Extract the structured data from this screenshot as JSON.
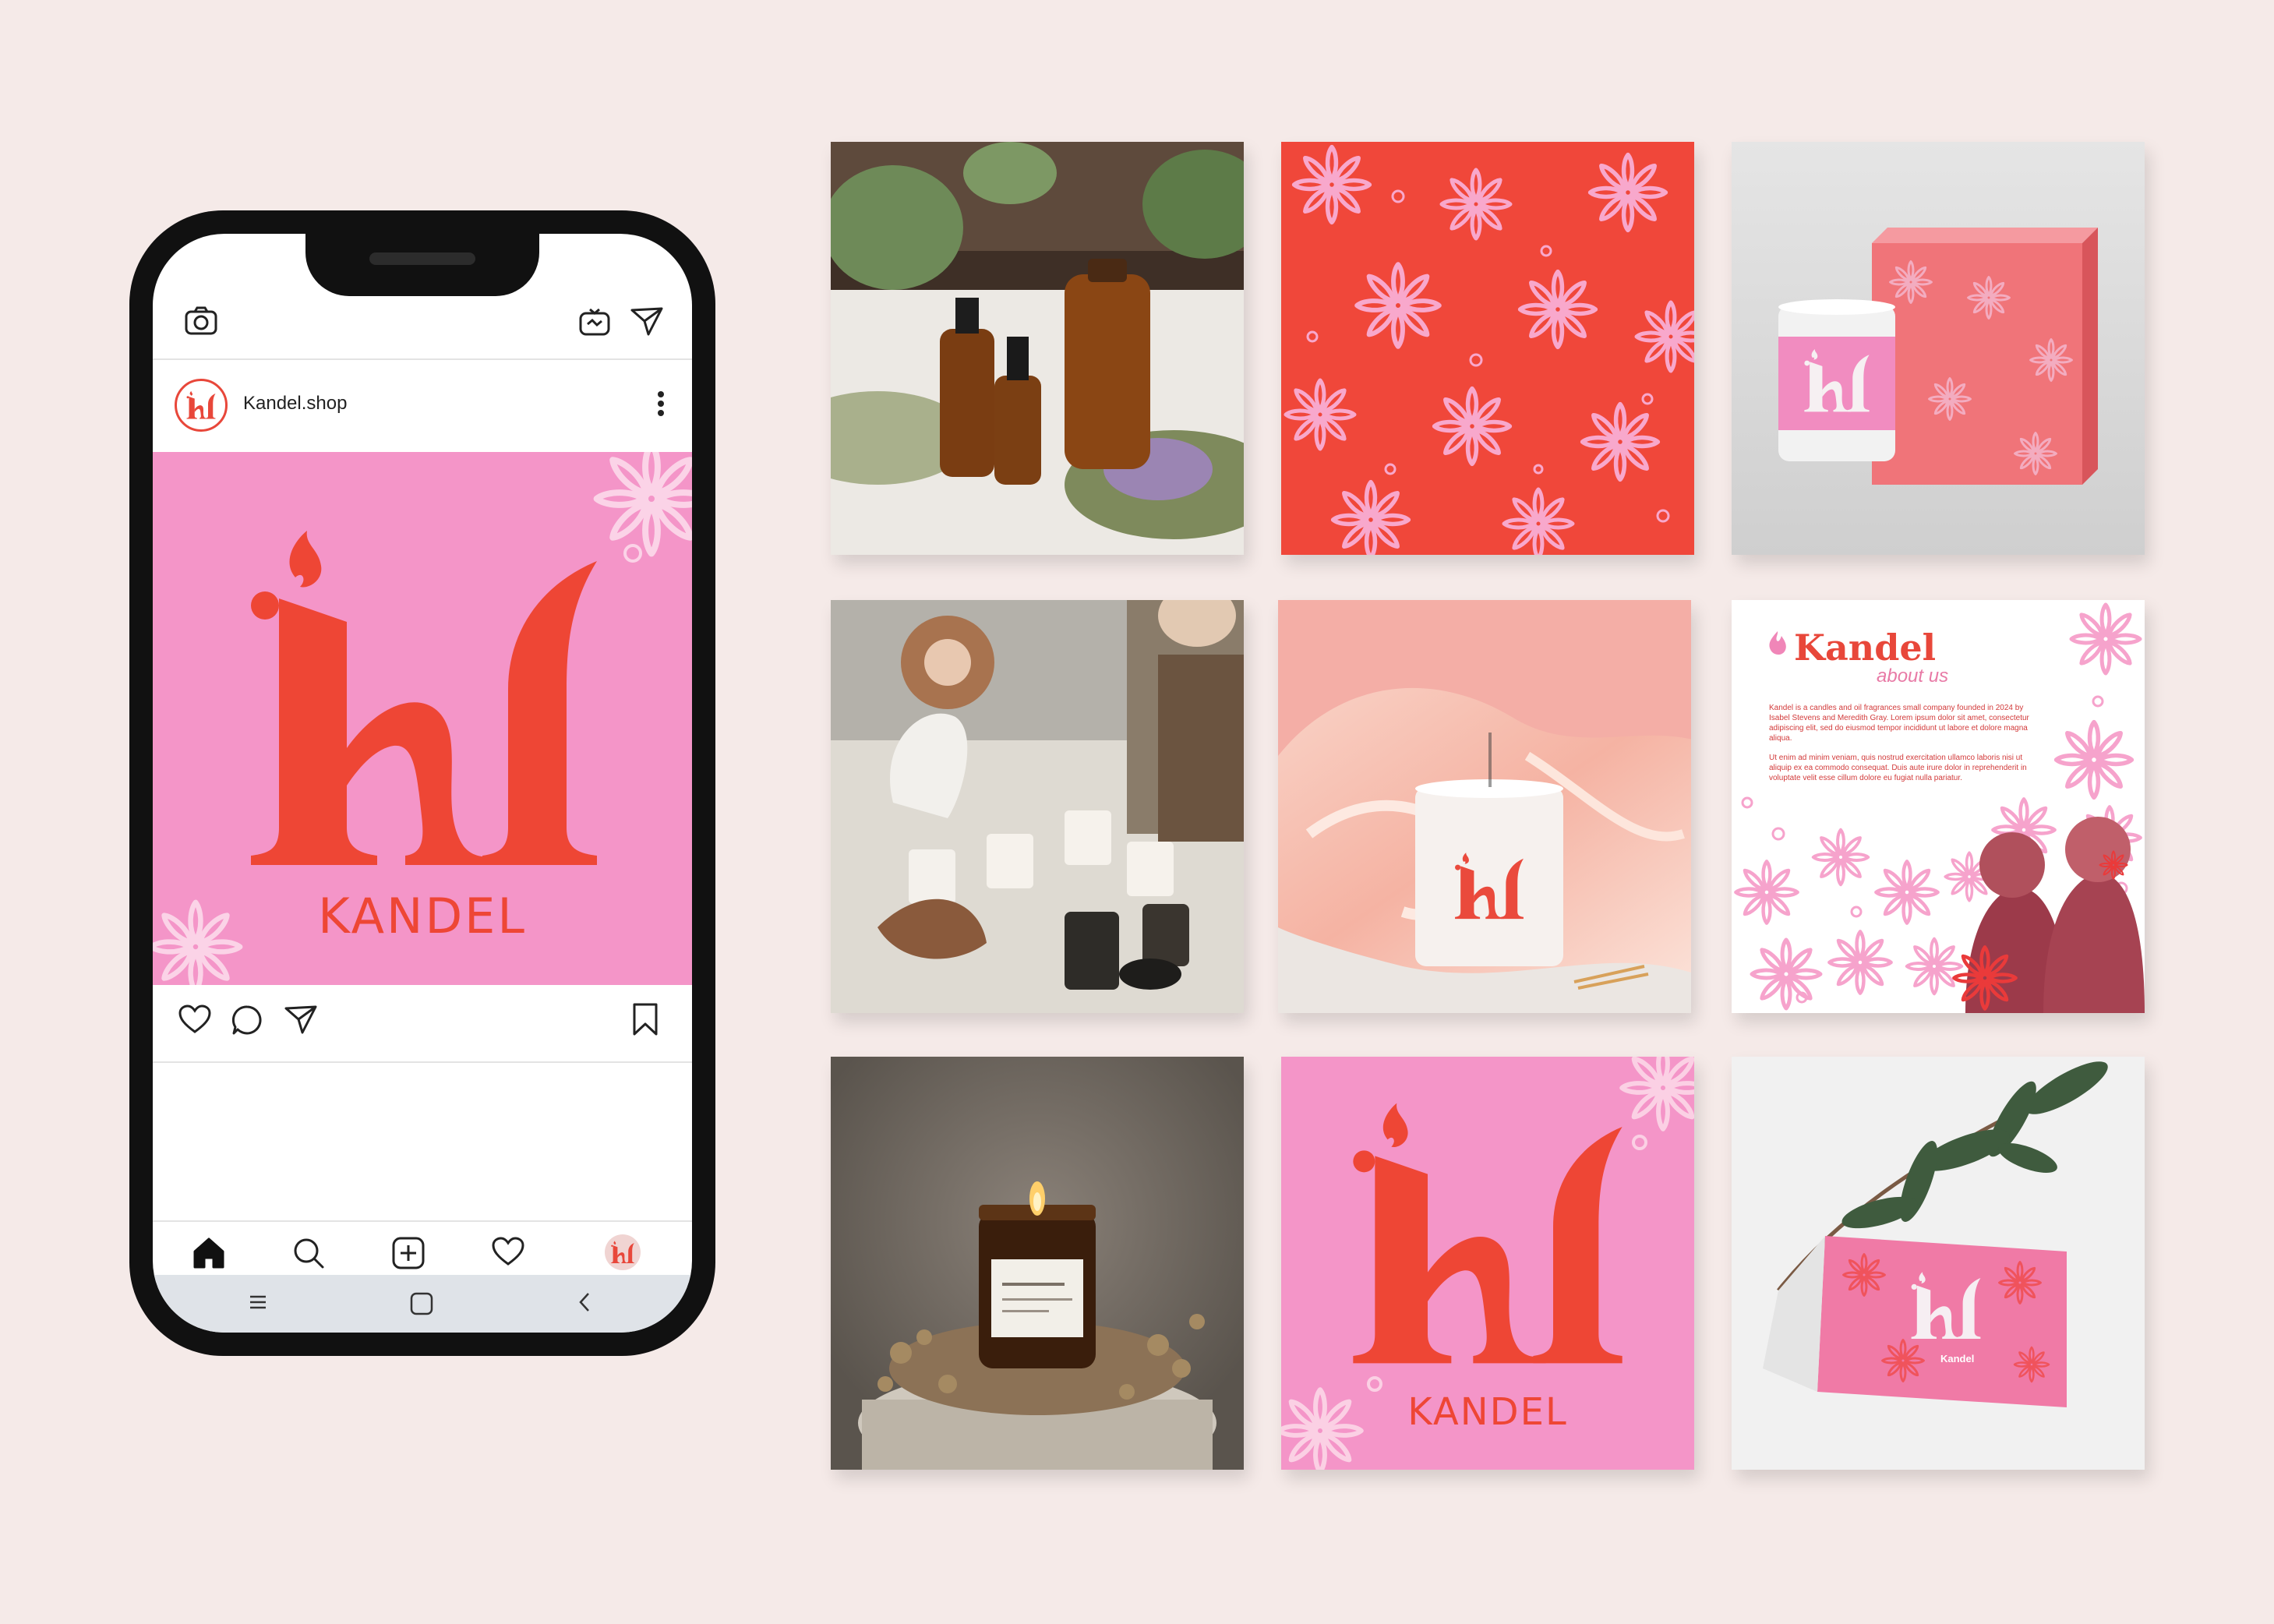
{
  "brand": {
    "name": "KANDEL",
    "monogram": "kl",
    "primary_color": "#ee4635",
    "pink_color": "#f495c8",
    "background_color": "#f5eae8"
  },
  "phone": {
    "top_bar": {
      "camera_icon": "camera-icon",
      "igtv_icon": "igtv-icon",
      "direct_icon": "paper-plane-icon"
    },
    "post": {
      "username": "Kandel.shop",
      "avatar_monogram": "kl",
      "logo_word": "KANDEL"
    },
    "actions": [
      "heart-icon",
      "comment-icon",
      "paper-plane-icon",
      "bookmark-icon"
    ],
    "bottom_nav": [
      "home-icon",
      "search-icon",
      "add-post-icon",
      "heart-icon",
      "profile-avatar"
    ],
    "system_nav": [
      "menu-icon",
      "home-square-icon",
      "back-chevron-icon"
    ]
  },
  "grid": {
    "tiles": [
      {
        "name": "essential-oils-photo"
      },
      {
        "name": "floral-pattern"
      },
      {
        "name": "candle-box-mockup"
      },
      {
        "name": "candle-making-photo"
      },
      {
        "name": "candle-satin-photo"
      },
      {
        "name": "about-us-post"
      },
      {
        "name": "lit-candle-photo"
      },
      {
        "name": "logo-post"
      },
      {
        "name": "gift-card-mockup"
      }
    ],
    "about": {
      "title": "Kandel",
      "subtitle": "about us",
      "paragraph_1": "Kandel is a candles and oil fragrances small company founded in 2024 by Isabel Stevens and Meredith Gray. Lorem ipsum dolor sit amet, consectetur adipiscing elit, sed do eiusmod tempor incididunt ut labore et dolore magna aliqua.",
      "paragraph_2": "Ut enim ad minim veniam, quis nostrud exercitation ullamco laboris nisi ut aliquip ex ea commodo consequat. Duis aute irure dolor in reprehenderit in voluptate velit esse cillum dolore eu fugiat nulla pariatur."
    },
    "logo_tile_word": "KANDEL",
    "card_label": "Kandel"
  }
}
